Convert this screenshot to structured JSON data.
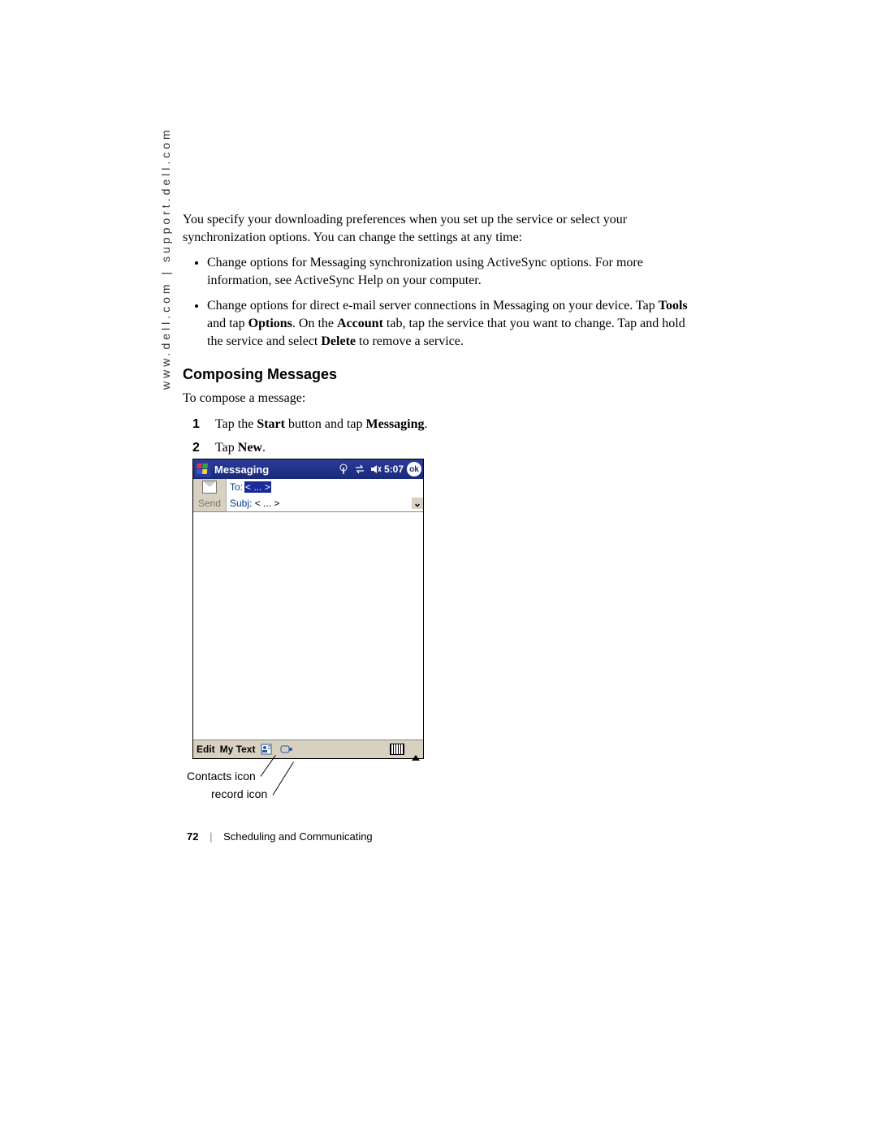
{
  "sidebar_url": "www.dell.com | support.dell.com",
  "intro_para": "You specify your downloading preferences when you set up the service or select your synchronization options. You can change the settings at any time:",
  "bullets": [
    "Change options for Messaging synchronization using ActiveSync options. For more information, see ActiveSync Help on your computer.",
    {
      "pre": "Change options for direct e-mail server connections in Messaging on your device. Tap ",
      "b1": "Tools",
      "mid1": " and tap ",
      "b2": "Options",
      "mid2": ". On the ",
      "b3": "Account",
      "mid3": " tab, tap the service that you want to change. Tap and hold the service and select ",
      "b4": "Delete",
      "post": " to remove a service."
    }
  ],
  "section_heading": "Composing Messages",
  "compose_intro": "To compose a message:",
  "steps": [
    {
      "pre": "Tap the ",
      "b1": "Start",
      "mid1": " button and tap ",
      "b2": "Messaging",
      "post": "."
    },
    {
      "pre": "Tap ",
      "b1": "New",
      "post": "."
    }
  ],
  "device": {
    "title": "Messaging",
    "time": "5:07",
    "ok": "ok",
    "to_label": "To:",
    "to_value": "< ... >",
    "subj_label": "Subj:",
    "subj_value": "< ... >",
    "send": "Send",
    "edit": "Edit",
    "mytext": "My Text"
  },
  "callouts": {
    "contacts": "Contacts icon",
    "record": "record icon"
  },
  "footer": {
    "page": "72",
    "section": "Scheduling and Communicating"
  }
}
